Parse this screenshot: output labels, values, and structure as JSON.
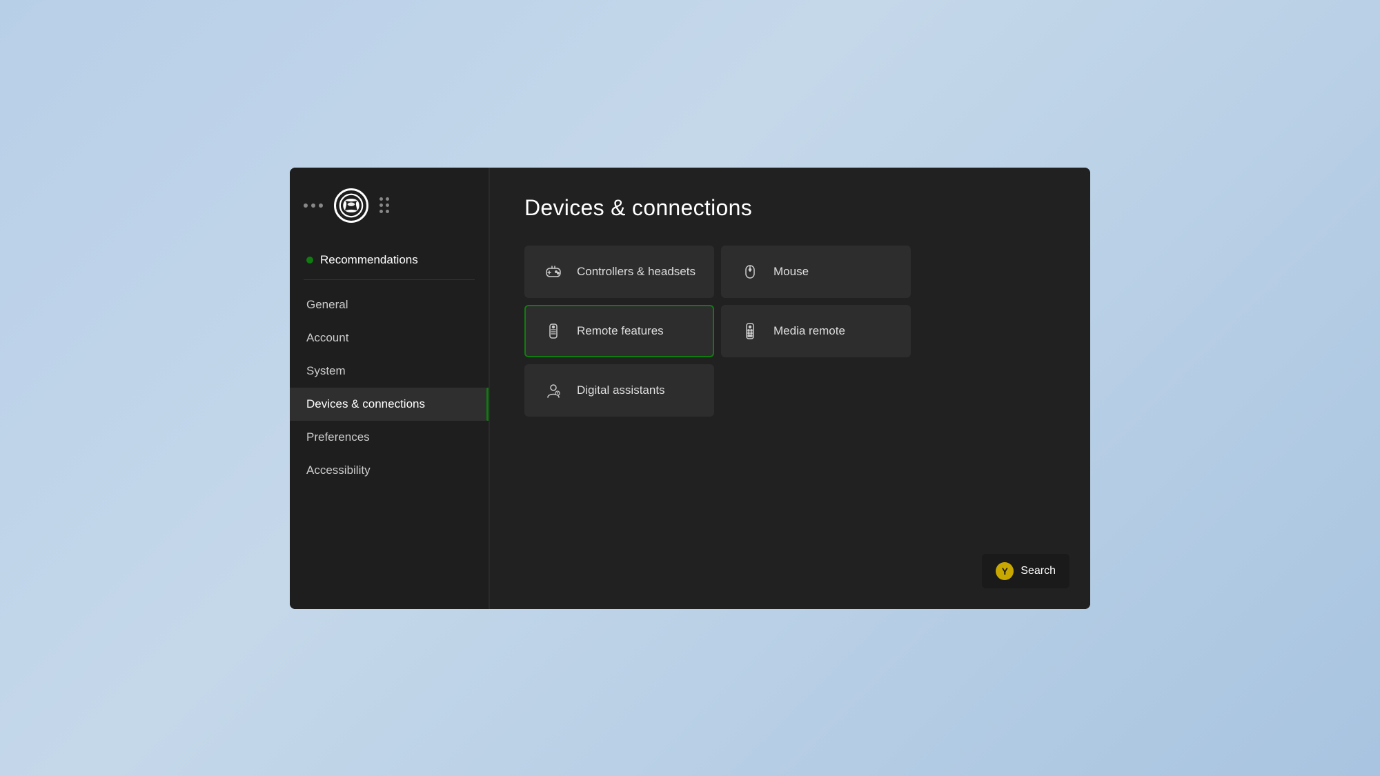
{
  "window": {
    "title": "Devices & connections"
  },
  "sidebar": {
    "logo_alt": "Xbox logo",
    "nav_items": [
      {
        "id": "recommendations",
        "label": "Recommendations",
        "has_dot": true,
        "active": false,
        "is_recommendations": true
      },
      {
        "id": "general",
        "label": "General",
        "has_dot": false,
        "active": false
      },
      {
        "id": "account",
        "label": "Account",
        "has_dot": false,
        "active": false
      },
      {
        "id": "system",
        "label": "System",
        "has_dot": false,
        "active": false
      },
      {
        "id": "devices-connections",
        "label": "Devices & connections",
        "has_dot": false,
        "active": true
      },
      {
        "id": "preferences",
        "label": "Preferences",
        "has_dot": false,
        "active": false
      },
      {
        "id": "accessibility",
        "label": "Accessibility",
        "has_dot": false,
        "active": false
      }
    ]
  },
  "main": {
    "title": "Devices & connections",
    "grid_items": [
      {
        "id": "controllers-headsets",
        "label": "Controllers & headsets",
        "icon": "controller-icon",
        "selected": false
      },
      {
        "id": "mouse",
        "label": "Mouse",
        "icon": "mouse-icon",
        "selected": false
      },
      {
        "id": "remote-features",
        "label": "Remote features",
        "icon": "remote-icon",
        "selected": true
      },
      {
        "id": "media-remote",
        "label": "Media remote",
        "icon": "media-remote-icon",
        "selected": false
      },
      {
        "id": "digital-assistants",
        "label": "Digital assistants",
        "icon": "assistant-icon",
        "selected": false
      }
    ]
  },
  "search_button": {
    "label": "Search",
    "y_symbol": "Y"
  },
  "colors": {
    "green": "#107c10",
    "yellow": "#c8a800",
    "active_border": "#107c10"
  }
}
